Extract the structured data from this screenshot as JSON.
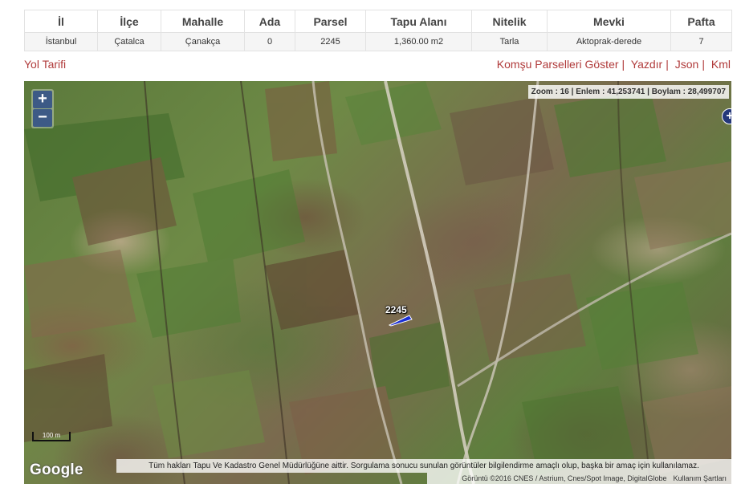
{
  "table": {
    "headers": [
      "İl",
      "İlçe",
      "Mahalle",
      "Ada",
      "Parsel",
      "Tapu Alanı",
      "Nitelik",
      "Mevki",
      "Pafta"
    ],
    "row": [
      "İstanbul",
      "Çatalca",
      "Çanakça",
      "0",
      "2245",
      "1,360.00 m2",
      "Tarla",
      "Aktoprak-derede",
      "7"
    ]
  },
  "links": {
    "route": "Yol Tarifi",
    "neighbors": "Komşu Parselleri Göster",
    "print": "Yazdır",
    "json": "Json",
    "kml": "Kml",
    "separator": "|"
  },
  "map": {
    "zoom_in": "+",
    "zoom_out": "−",
    "coords": "Zoom : 16 | Enlem : 41,253741 | Boylam : 28,499707",
    "layers_button": "+",
    "parcel_label": "2245",
    "scale_text": "100 m",
    "google_logo": "Google",
    "disclaimer": "Tüm hakları Tapu Ve Kadastro Genel Müdürlüğüne aittir. Sorgulama sonucu sunulan görüntüler bilgilendirme amaçlı olup, başka bir amaç için kullanılamaz.",
    "imagery": "Görüntü ©2016 CNES / Astrium, Cnes/Spot Image, DigitalGlobe",
    "terms": "Kullanım Şartları",
    "parcel_color": "#1a2fd6",
    "link_color": "#b03a3a"
  }
}
